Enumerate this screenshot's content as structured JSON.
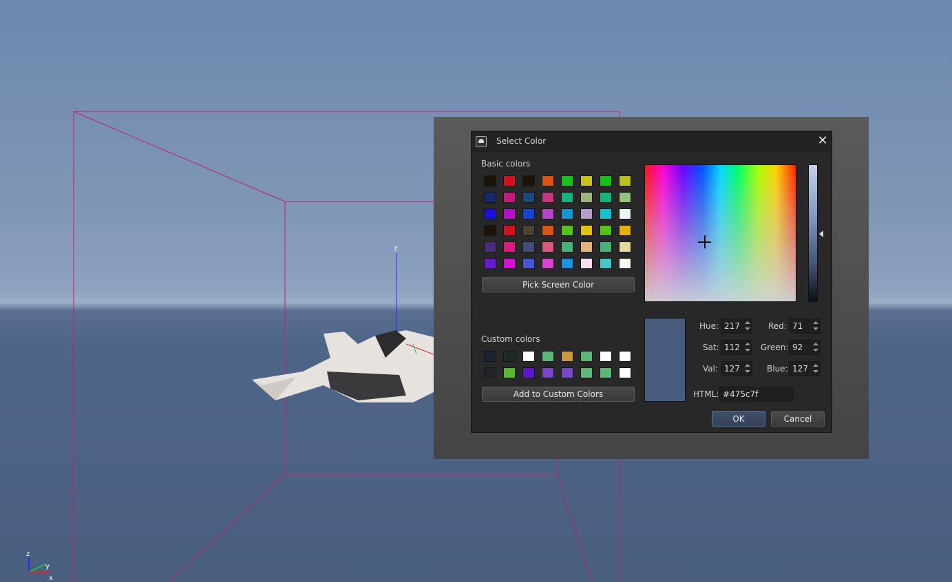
{
  "dialog": {
    "title": "Select Color",
    "close_glyph": "✕",
    "app_icon": "app-logo-icon"
  },
  "basic_colors": {
    "label": "Basic colors",
    "rows": [
      [
        "#1a1307",
        "#d0101a",
        "#1a1307",
        "#d8560f",
        "#16c21a",
        "#c8c21a",
        "#16c21a",
        "#b8c21a"
      ],
      [
        "#162a6a",
        "#c21a7a",
        "#1a4a7a",
        "#c23a7a",
        "#16b47a",
        "#9ab47a",
        "#16b47a",
        "#9ac27a"
      ],
      [
        "#1610d8",
        "#b410c8",
        "#1646d0",
        "#b446c8",
        "#1696d0",
        "#b4a0c8",
        "#16c2d0",
        "#e8f8f8"
      ],
      [
        "#1a1307",
        "#d0101a",
        "#4a4530",
        "#d8560f",
        "#56c21a",
        "#e2c20a",
        "#56c21a",
        "#e2b40a"
      ],
      [
        "#4a2a7a",
        "#d81a7a",
        "#464c7a",
        "#d85a7a",
        "#46b47a",
        "#e2b47a",
        "#46b47a",
        "#e8d89a"
      ],
      [
        "#6a1ad0",
        "#d810d8",
        "#4656d0",
        "#d846d0",
        "#1696e0",
        "#f8e0f0",
        "#46c8c8",
        "#f8f8f0"
      ]
    ]
  },
  "pick_screen_label": "Pick Screen Color",
  "custom_colors": {
    "label": "Custom colors",
    "rows": [
      [
        "#1b2230",
        "#1e2a2a",
        "#ffffff",
        "#5cb878",
        "#c89a3a",
        "#5cb878",
        "#ffffff",
        "#ffffff"
      ],
      [
        "#222428",
        "#5ab830",
        "#5a18c8",
        "#7a46c8",
        "#7a46c8",
        "#5cb878",
        "#5cb878",
        "#ffffff"
      ]
    ]
  },
  "add_custom_label": "Add to Custom Colors",
  "current_color": "#475c7f",
  "hsv": {
    "hue_label": "Hue:",
    "hue": "217",
    "sat_label": "Sat:",
    "sat": "112",
    "val_label": "Val:",
    "val": "127"
  },
  "rgb": {
    "red_label": "Red:",
    "red": "71",
    "green_label": "Green:",
    "green": "92",
    "blue_label": "Blue:",
    "blue": "127"
  },
  "html": {
    "label": "HTML:",
    "value": "#475c7f"
  },
  "buttons": {
    "ok": "OK",
    "cancel": "Cancel"
  },
  "scene": {
    "axis_labels": [
      "z",
      "y",
      "x"
    ],
    "gizmo_label": "z",
    "colors": {
      "sky": "#7f96b6",
      "ground": "#4a5f80",
      "bounds": "#c0207a"
    }
  }
}
